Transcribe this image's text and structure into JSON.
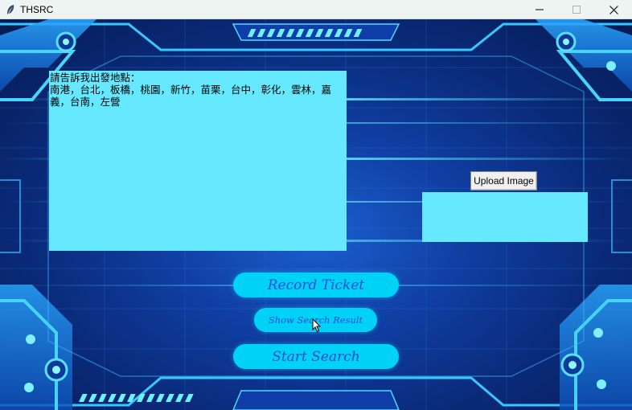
{
  "window": {
    "title": "THSRC",
    "app_icon": "feather-icon",
    "controls": [
      "minimize-icon",
      "maximize-icon",
      "close-icon"
    ]
  },
  "main": {
    "text_panel": {
      "text": "請告訴我出發地點：\n南港，台北，板橋，桃園，新竹，苗栗，台中，彰化，雲林，嘉義，台南，左營"
    },
    "upload_button_label": "Upload Image",
    "record_ticket_label": "Record Ticket",
    "show_search_result_label": "Show Search Result",
    "start_search_label": "Start Search"
  },
  "colors": {
    "panel": "#66e8ff",
    "pill_button": "#00d2f7",
    "pill_text": "#2a4dd4",
    "titlebar": "#eef4f2"
  }
}
